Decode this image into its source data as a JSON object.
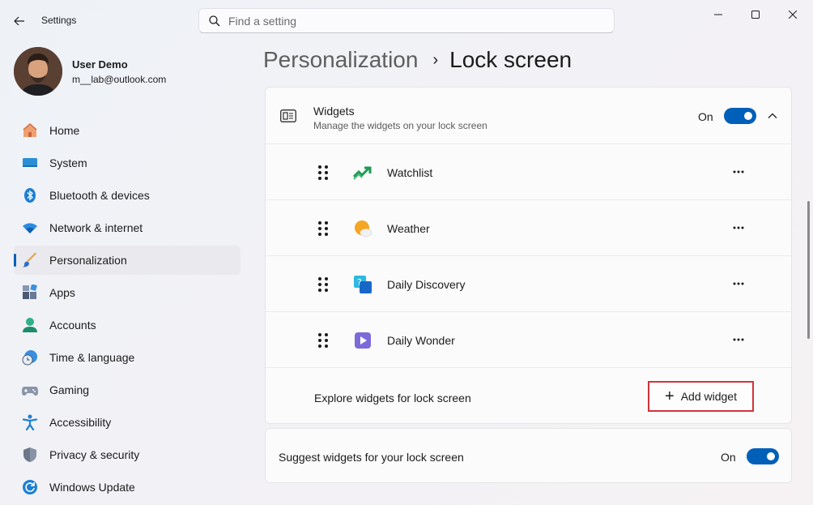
{
  "window": {
    "app_title": "Settings"
  },
  "search": {
    "placeholder": "Find a setting"
  },
  "profile": {
    "name": "User Demo",
    "email": "m__lab@outlook.com"
  },
  "sidebar": {
    "items": [
      {
        "label": "Home",
        "icon": "home-icon",
        "active": false
      },
      {
        "label": "System",
        "icon": "system-icon",
        "active": false
      },
      {
        "label": "Bluetooth & devices",
        "icon": "bluetooth-icon",
        "active": false
      },
      {
        "label": "Network & internet",
        "icon": "wifi-icon",
        "active": false
      },
      {
        "label": "Personalization",
        "icon": "brush-icon",
        "active": true
      },
      {
        "label": "Apps",
        "icon": "apps-icon",
        "active": false
      },
      {
        "label": "Accounts",
        "icon": "accounts-icon",
        "active": false
      },
      {
        "label": "Time & language",
        "icon": "clock-globe-icon",
        "active": false
      },
      {
        "label": "Gaming",
        "icon": "gamepad-icon",
        "active": false
      },
      {
        "label": "Accessibility",
        "icon": "accessibility-icon",
        "active": false
      },
      {
        "label": "Privacy & security",
        "icon": "shield-icon",
        "active": false
      },
      {
        "label": "Windows Update",
        "icon": "update-icon",
        "active": false
      }
    ]
  },
  "breadcrumb": {
    "parent": "Personalization",
    "separator": "›",
    "current": "Lock screen"
  },
  "widgets_card": {
    "title": "Widgets",
    "subtitle": "Manage the widgets on your lock screen",
    "toggle_label": "On",
    "toggle_on": true,
    "items": [
      {
        "name": "Watchlist",
        "icon": "watchlist-icon"
      },
      {
        "name": "Weather",
        "icon": "weather-icon"
      },
      {
        "name": "Daily Discovery",
        "icon": "daily-discovery-icon"
      },
      {
        "name": "Daily Wonder",
        "icon": "daily-wonder-icon"
      }
    ],
    "explore_text": "Explore widgets for lock screen",
    "add_button_label": "Add widget"
  },
  "suggest_card": {
    "text": "Suggest widgets for your lock screen",
    "toggle_label": "On",
    "toggle_on": true
  },
  "colors": {
    "accent": "#005fb8",
    "highlight_border": "#d1343b"
  }
}
